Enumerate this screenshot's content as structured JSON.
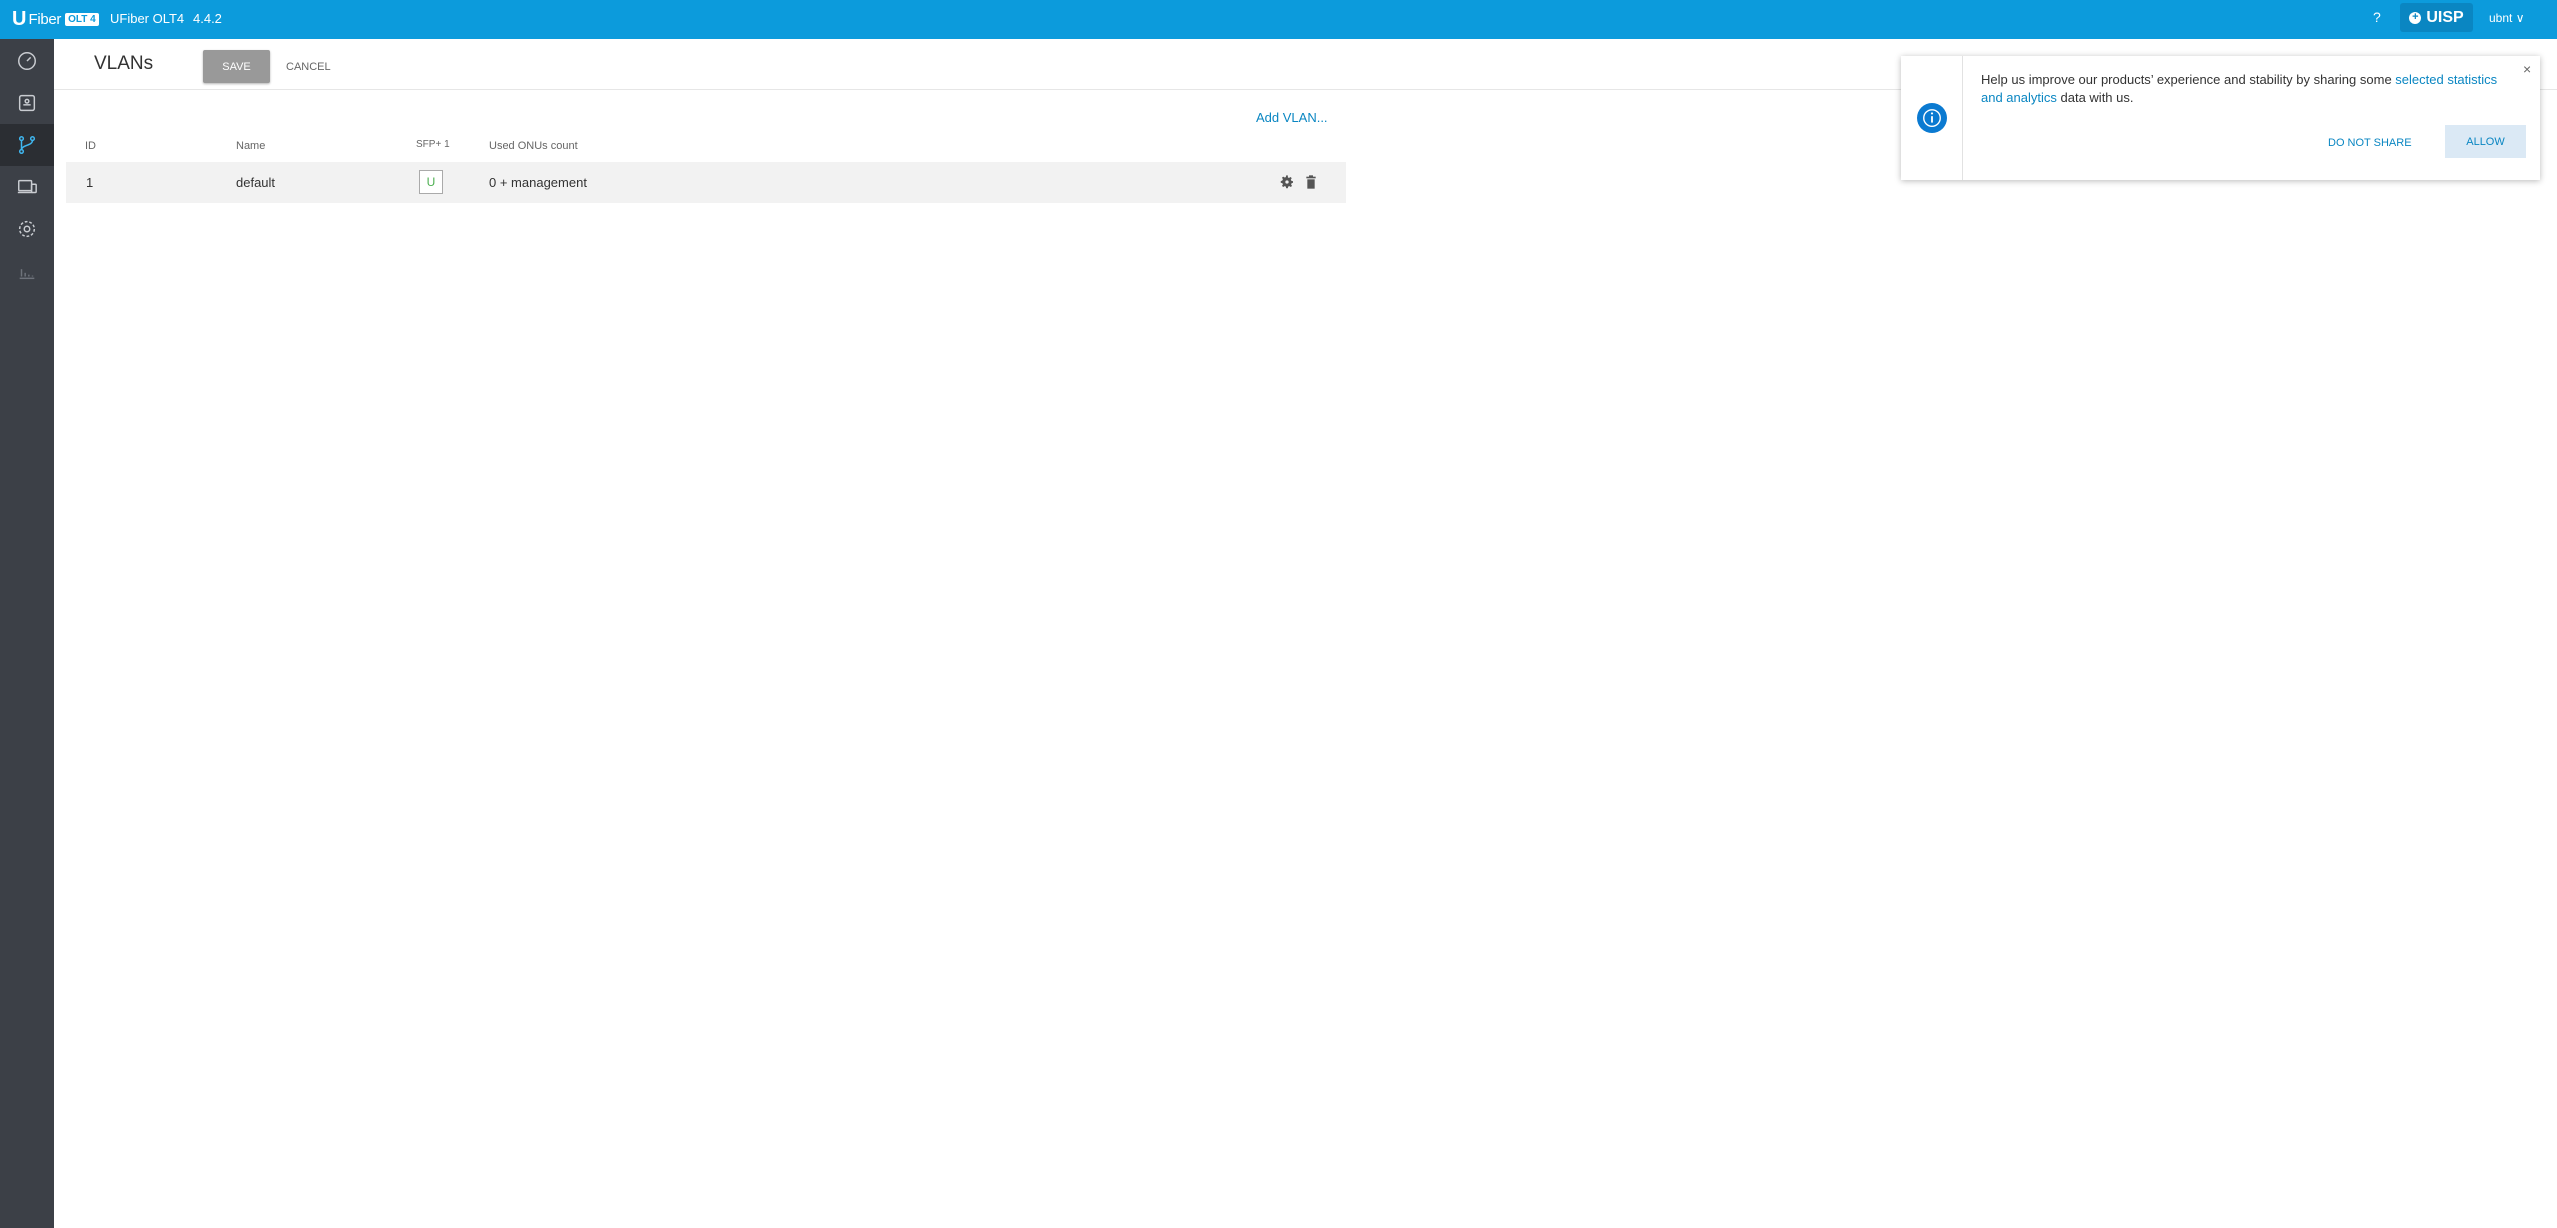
{
  "topbar": {
    "logo_u": "U",
    "logo_fiber": "Fiber",
    "logo_olt": "OLT 4",
    "device_name": "UFiber OLT4",
    "firmware": "4.4.2",
    "help": "?",
    "uisp_label": "UISP",
    "user": "ubnt ∨"
  },
  "sidebar": {
    "items": [
      {
        "name": "dashboard",
        "icon": "speedometer-icon",
        "active": false
      },
      {
        "name": "onu-list",
        "icon": "device-icon",
        "active": false
      },
      {
        "name": "vlans",
        "icon": "network-icon",
        "active": true
      },
      {
        "name": "onu-devices",
        "icon": "devices-icon",
        "active": false
      },
      {
        "name": "settings",
        "icon": "gear-icon",
        "active": false
      },
      {
        "name": "statistics",
        "icon": "bar-chart-icon",
        "active": false
      }
    ]
  },
  "header": {
    "title": "VLANs",
    "save_label": "SAVE",
    "cancel_label": "CANCEL"
  },
  "table": {
    "add_label": "Add VLAN...",
    "columns": [
      "ID",
      "Name",
      "SFP+ 1",
      "Used ONUs count"
    ],
    "rows": [
      {
        "id": "1",
        "name": "default",
        "sfp": "U",
        "used": "0 + management"
      }
    ]
  },
  "popup": {
    "text_before": "Help us improve our products’ experience and stability by sharing some ",
    "link_text": "selected statistics and analytics",
    "text_after": " data with us.",
    "close": "×",
    "do_not_share_label": "DO NOT SHARE",
    "allow_label": "ALLOW"
  },
  "colors": {
    "topbar": "#0c9bdc",
    "sidebar": "#3c4047",
    "accent": "#0a86c2",
    "untagged": "#4caf50"
  }
}
